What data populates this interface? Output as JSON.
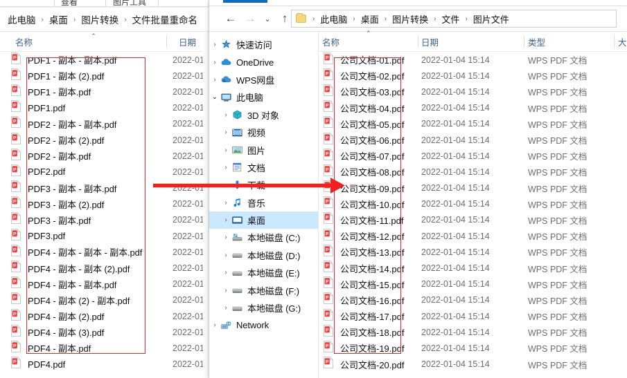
{
  "left_window": {
    "ribbon_ghost_items": [
      "查看",
      "图片工具"
    ],
    "breadcrumb": [
      "此电脑",
      "桌面",
      "图片转换",
      "文件批量重命名"
    ],
    "breadcrumb_separator": "›",
    "columns": {
      "name": "名称",
      "date": "日期",
      "sort_caret": "⌃"
    },
    "files": [
      {
        "name": "PDF1 - 副本 - 副本.pdf",
        "date": "2022-01"
      },
      {
        "name": "PDF1 - 副本 (2).pdf",
        "date": "2022-01"
      },
      {
        "name": "PDF1 - 副本.pdf",
        "date": "2022-01"
      },
      {
        "name": "PDF1.pdf",
        "date": "2022-01"
      },
      {
        "name": "PDF2 - 副本 - 副本.pdf",
        "date": "2022-01"
      },
      {
        "name": "PDF2 - 副本 (2).pdf",
        "date": "2022-01"
      },
      {
        "name": "PDF2 - 副本.pdf",
        "date": "2022-01"
      },
      {
        "name": "PDF2.pdf",
        "date": "2022-01"
      },
      {
        "name": "PDF3 - 副本 - 副本.pdf",
        "date": "2022-01"
      },
      {
        "name": "PDF3 - 副本 (2).pdf",
        "date": "2022-01"
      },
      {
        "name": "PDF3 - 副本.pdf",
        "date": "2022-01"
      },
      {
        "name": "PDF3.pdf",
        "date": "2022-01"
      },
      {
        "name": "PDF4 - 副本 - 副本 - 副本.pdf",
        "date": "2022-01"
      },
      {
        "name": "PDF4 - 副本 - 副本 (2).pdf",
        "date": "2022-01"
      },
      {
        "name": "PDF4 - 副本 - 副本.pdf",
        "date": "2022-01"
      },
      {
        "name": "PDF4 - 副本 (2) - 副本.pdf",
        "date": "2022-01"
      },
      {
        "name": "PDF4 - 副本 (2).pdf",
        "date": "2022-01"
      },
      {
        "name": "PDF4 - 副本 (3).pdf",
        "date": "2022-01"
      },
      {
        "name": "PDF4 - 副本.pdf",
        "date": "2022-01"
      },
      {
        "name": "PDF4.pdf",
        "date": "2022-01"
      }
    ]
  },
  "right_window": {
    "nav": {
      "back_icon": "←",
      "forward_icon": "→",
      "recent_icon": "⌄",
      "up_icon": "↑"
    },
    "breadcrumb": [
      "此电脑",
      "桌面",
      "图片转换",
      "文件",
      "图片文件"
    ],
    "breadcrumb_separator": "›",
    "tree": [
      {
        "label": "快速访问",
        "icon": "star-pin-icon",
        "expanded": false,
        "indent": 0,
        "selected": false
      },
      {
        "label": "OneDrive",
        "icon": "cloud-icon",
        "expanded": false,
        "indent": 0,
        "selected": false
      },
      {
        "label": "WPS网盘",
        "icon": "wps-cloud-icon",
        "expanded": false,
        "indent": 0,
        "selected": false
      },
      {
        "label": "此电脑",
        "icon": "computer-icon",
        "expanded": true,
        "indent": 0,
        "selected": false
      },
      {
        "label": "3D 对象",
        "icon": "cube-icon",
        "expanded": false,
        "indent": 1,
        "selected": false
      },
      {
        "label": "视频",
        "icon": "video-icon",
        "expanded": false,
        "indent": 1,
        "selected": false
      },
      {
        "label": "图片",
        "icon": "picture-icon",
        "expanded": false,
        "indent": 1,
        "selected": false
      },
      {
        "label": "文档",
        "icon": "document-icon",
        "expanded": false,
        "indent": 1,
        "selected": false
      },
      {
        "label": "下载",
        "icon": "download-icon",
        "expanded": false,
        "indent": 1,
        "selected": false
      },
      {
        "label": "音乐",
        "icon": "music-icon",
        "expanded": false,
        "indent": 1,
        "selected": false
      },
      {
        "label": "桌面",
        "icon": "desktop-icon",
        "expanded": false,
        "indent": 1,
        "selected": true
      },
      {
        "label": "本地磁盘 (C:)",
        "icon": "system-drive-icon",
        "expanded": false,
        "indent": 1,
        "selected": false
      },
      {
        "label": "本地磁盘 (D:)",
        "icon": "drive-icon",
        "expanded": false,
        "indent": 1,
        "selected": false
      },
      {
        "label": "本地磁盘 (E:)",
        "icon": "drive-icon",
        "expanded": false,
        "indent": 1,
        "selected": false
      },
      {
        "label": "本地磁盘 (F:)",
        "icon": "drive-icon",
        "expanded": false,
        "indent": 1,
        "selected": false
      },
      {
        "label": "本地磁盘 (G:)",
        "icon": "drive-icon",
        "expanded": false,
        "indent": 1,
        "selected": false
      },
      {
        "label": "Network",
        "icon": "network-icon",
        "expanded": false,
        "indent": 0,
        "selected": false
      }
    ],
    "columns": {
      "name": "名称",
      "date": "日期",
      "type": "类型",
      "size": "大",
      "sort_caret": "⌃"
    },
    "files": [
      {
        "name": "公司文档-01.pdf",
        "date": "2022-01-04 15:14",
        "type": "WPS PDF 文档"
      },
      {
        "name": "公司文档-02.pdf",
        "date": "2022-01-04 15:14",
        "type": "WPS PDF 文档"
      },
      {
        "name": "公司文档-03.pdf",
        "date": "2022-01-04 15:14",
        "type": "WPS PDF 文档"
      },
      {
        "name": "公司文档-04.pdf",
        "date": "2022-01-04 15:14",
        "type": "WPS PDF 文档"
      },
      {
        "name": "公司文档-05.pdf",
        "date": "2022-01-04 15:14",
        "type": "WPS PDF 文档"
      },
      {
        "name": "公司文档-06.pdf",
        "date": "2022-01-04 15:14",
        "type": "WPS PDF 文档"
      },
      {
        "name": "公司文档-07.pdf",
        "date": "2022-01-04 15:14",
        "type": "WPS PDF 文档"
      },
      {
        "name": "公司文档-08.pdf",
        "date": "2022-01-04 15:14",
        "type": "WPS PDF 文档"
      },
      {
        "name": "公司文档-09.pdf",
        "date": "2022-01-04 15:14",
        "type": "WPS PDF 文档"
      },
      {
        "name": "公司文档-10.pdf",
        "date": "2022-01-04 15:14",
        "type": "WPS PDF 文档"
      },
      {
        "name": "公司文档-11.pdf",
        "date": "2022-01-04 15:14",
        "type": "WPS PDF 文档"
      },
      {
        "name": "公司文档-12.pdf",
        "date": "2022-01-04 15:14",
        "type": "WPS PDF 文档"
      },
      {
        "name": "公司文档-13.pdf",
        "date": "2022-01-04 15:14",
        "type": "WPS PDF 文档"
      },
      {
        "name": "公司文档-14.pdf",
        "date": "2022-01-04 15:14",
        "type": "WPS PDF 文档"
      },
      {
        "name": "公司文档-15.pdf",
        "date": "2022-01-04 15:14",
        "type": "WPS PDF 文档"
      },
      {
        "name": "公司文档-16.pdf",
        "date": "2022-01-04 15:14",
        "type": "WPS PDF 文档"
      },
      {
        "name": "公司文档-17.pdf",
        "date": "2022-01-04 15:14",
        "type": "WPS PDF 文档"
      },
      {
        "name": "公司文档-18.pdf",
        "date": "2022-01-04 15:14",
        "type": "WPS PDF 文档"
      },
      {
        "name": "公司文档-19.pdf",
        "date": "2022-01-04 15:14",
        "type": "WPS PDF 文档"
      },
      {
        "name": "公司文档-20.pdf",
        "date": "2022-01-04 15:14",
        "type": "WPS PDF 文档"
      }
    ]
  },
  "annotations": {
    "arrow_color": "#f22020",
    "highlight_box_color": "#e8262a",
    "accent_color": "#0f6cbd",
    "selection_color": "#cce8ff"
  }
}
